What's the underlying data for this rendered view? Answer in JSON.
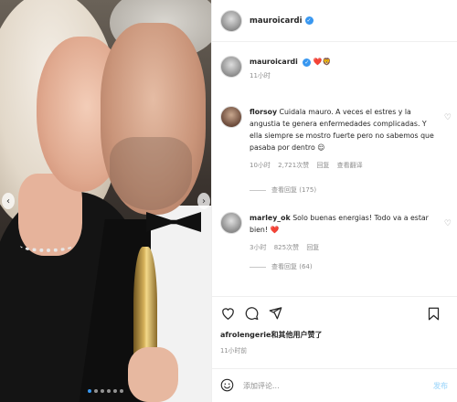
{
  "header": {
    "username": "mauroicardi",
    "verified": true
  },
  "caption": {
    "username": "mauroicardi",
    "emojis": "❤️🦁",
    "time": "11小时"
  },
  "comments": [
    {
      "username": "florsoy",
      "text": "Cuidala mauro. A veces el estres y la angustia te genera enfermedades complicadas. Y ella siempre se mostro fuerte pero no sabemos que pasaba por dentro",
      "emoji": "😌",
      "time": "10小时",
      "likes": "2,721次赞",
      "reply": "回复",
      "translate": "查看翻译",
      "view_replies": "查看回复 (175)"
    },
    {
      "username": "marley_ok",
      "text": "Solo buenas energias! Todo va a estar bien!",
      "emoji": "❤️",
      "time": "3小时",
      "likes": "825次赞",
      "reply": "回复",
      "view_replies": "查看回复 (64)"
    }
  ],
  "actions": {
    "like": "heart-outline-icon",
    "comment": "comment-icon",
    "share": "send-icon",
    "save": "bookmark-icon"
  },
  "likes_text": "afrolengerie和其他用户赞了",
  "post_time": "11小时前",
  "comment_input": {
    "placeholder": "添加评论...",
    "post_label": "发布"
  },
  "carousel": {
    "dot_count": 6,
    "active_dot": 0
  },
  "colors": {
    "link_blue": "#3897f0",
    "heart_red": "#ed4956",
    "meta_gray": "#8e8e8e",
    "post_btn_disabled": "#b2dffc"
  }
}
